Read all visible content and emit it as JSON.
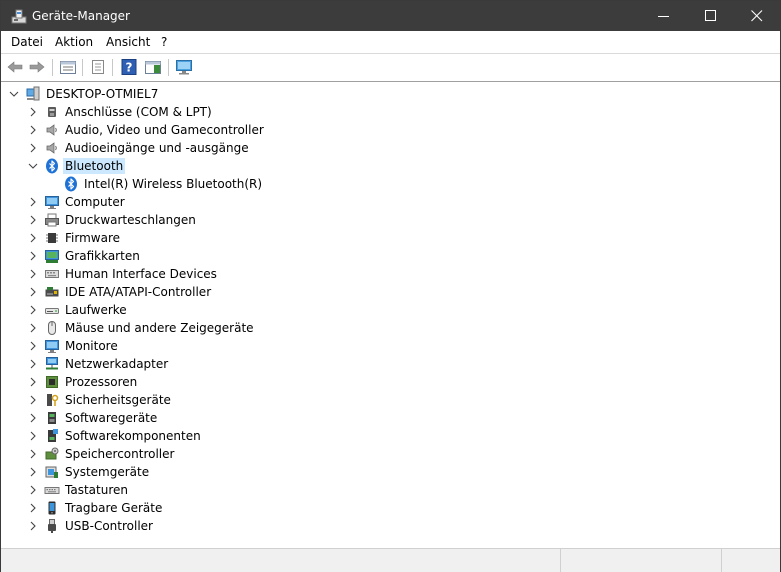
{
  "window": {
    "title": "Geräte-Manager",
    "app_icon": "device-manager-icon",
    "controls": [
      "minimize-icon",
      "maximize-icon",
      "close-icon"
    ]
  },
  "menu": {
    "items": [
      "Datei",
      "Aktion",
      "Ansicht",
      "?"
    ]
  },
  "toolbar": {
    "buttons": [
      "back-arrow-icon",
      "forward-arrow-icon",
      "console-tree-icon",
      "properties-icon",
      "help-icon",
      "action-pane-icon",
      "monitor-scan-icon"
    ]
  },
  "tree": {
    "root": {
      "label": "DESKTOP-OTMIEL7",
      "icon": "computer-icon",
      "expanded": true
    },
    "categories": [
      {
        "label": "Anschlüsse (COM & LPT)",
        "icon": "port-icon"
      },
      {
        "label": "Audio, Video und Gamecontroller",
        "icon": "speaker-icon"
      },
      {
        "label": "Audioeingänge und -ausgänge",
        "icon": "speaker-icon"
      },
      {
        "label": "Bluetooth",
        "icon": "bluetooth-icon",
        "expanded": true,
        "selected": true,
        "children": [
          {
            "label": "Intel(R) Wireless Bluetooth(R)",
            "icon": "bluetooth-icon"
          }
        ]
      },
      {
        "label": "Computer",
        "icon": "monitor-icon"
      },
      {
        "label": "Druckwarteschlangen",
        "icon": "printer-icon"
      },
      {
        "label": "Firmware",
        "icon": "chip-icon"
      },
      {
        "label": "Grafikkarten",
        "icon": "display-adapter-icon"
      },
      {
        "label": "Human Interface Devices",
        "icon": "hid-icon"
      },
      {
        "label": "IDE ATA/ATAPI-Controller",
        "icon": "ide-controller-icon"
      },
      {
        "label": "Laufwerke",
        "icon": "drive-icon"
      },
      {
        "label": "Mäuse und andere Zeigegeräte",
        "icon": "mouse-icon"
      },
      {
        "label": "Monitore",
        "icon": "monitor-icon"
      },
      {
        "label": "Netzwerkadapter",
        "icon": "network-icon"
      },
      {
        "label": "Prozessoren",
        "icon": "processor-icon"
      },
      {
        "label": "Sicherheitsgeräte",
        "icon": "security-key-icon"
      },
      {
        "label": "Softwaregeräte",
        "icon": "software-device-icon"
      },
      {
        "label": "Softwarekomponenten",
        "icon": "software-component-icon"
      },
      {
        "label": "Speichercontroller",
        "icon": "storage-controller-icon"
      },
      {
        "label": "Systemgeräte",
        "icon": "system-device-icon"
      },
      {
        "label": "Tastaturen",
        "icon": "keyboard-icon"
      },
      {
        "label": "Tragbare Geräte",
        "icon": "portable-device-icon"
      },
      {
        "label": "USB-Controller",
        "icon": "usb-icon"
      }
    ]
  },
  "colors": {
    "titlebar": "#3c3c3c",
    "selection": "#cce8ff",
    "statusbar": "#f0f0f0"
  }
}
